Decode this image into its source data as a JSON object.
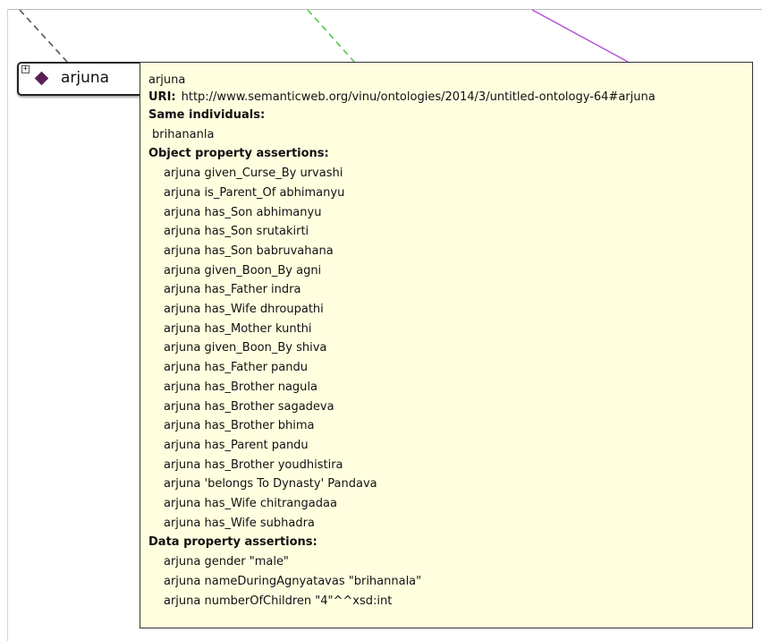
{
  "node": {
    "expand_symbol": "+",
    "label": "arjuna",
    "icon": "individual-diamond-icon",
    "icon_color": "#5b1f56"
  },
  "tooltip": {
    "title": "arjuna",
    "uri_label": "URI:",
    "uri": "http://www.semanticweb.org/vinu/ontologies/2014/3/untitled-ontology-64#arjuna",
    "same_individuals_heading": "Same individuals:",
    "same_individuals": [
      "brihananla"
    ],
    "object_property_heading": "Object property assertions:",
    "object_property_assertions": [
      "arjuna given_Curse_By urvashi",
      "arjuna is_Parent_Of abhimanyu",
      "arjuna has_Son abhimanyu",
      "arjuna has_Son srutakirti",
      "arjuna has_Son babruvahana",
      "arjuna given_Boon_By agni",
      "arjuna has_Father indra",
      "arjuna has_Wife dhroupathi",
      "arjuna has_Mother kunthi",
      "arjuna given_Boon_By shiva",
      "arjuna has_Father pandu",
      "arjuna has_Brother nagula",
      "arjuna has_Brother sagadeva",
      "arjuna has_Brother bhima",
      "arjuna has_Parent pandu",
      "arjuna has_Brother youdhistira",
      "arjuna 'belongs To Dynasty' Pandava",
      "arjuna has_Wife chitrangadaa",
      "arjuna has_Wife subhadra"
    ],
    "data_property_heading": "Data property assertions:",
    "data_property_assertions": [
      "arjuna gender \"male\"",
      "arjuna nameDuringAgnyatavas \"brihannala\"",
      "arjuna numberOfChildren \"4\"^^xsd:int"
    ]
  },
  "colors": {
    "tooltip_background": "#ffffe0",
    "edge_dark": "#555555",
    "edge_green": "#4cc94c",
    "edge_purple": "#b44fd8"
  }
}
